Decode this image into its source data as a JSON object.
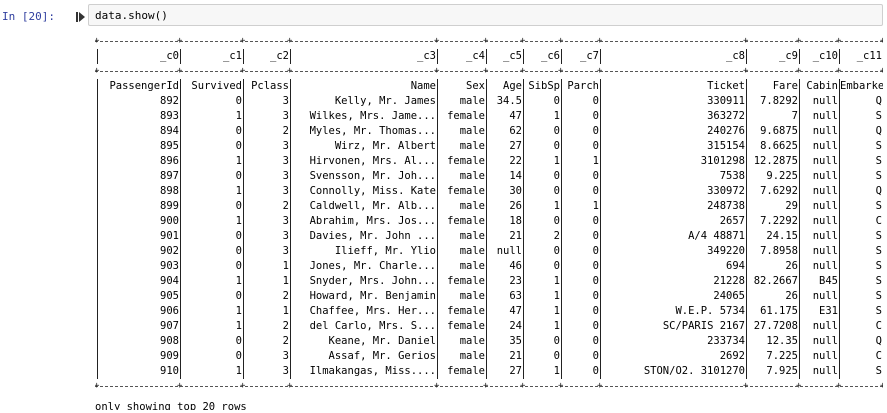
{
  "prompt_label": "In [20]:",
  "code": "data.show()",
  "columns_header": [
    "_c0",
    "_c1",
    "_c2",
    "_c3",
    "_c4",
    "_c5",
    "_c6",
    "_c7",
    "_c8",
    "_c9",
    "_c10",
    "_c11"
  ],
  "rows": [
    [
      "PassengerId",
      "Survived",
      "Pclass",
      "Name",
      "Sex",
      "Age",
      "SibSp",
      "Parch",
      "Ticket",
      "Fare",
      "Cabin",
      "Embarked"
    ],
    [
      "892",
      "0",
      "3",
      "Kelly, Mr. James",
      "male",
      "34.5",
      "0",
      "0",
      "330911",
      "7.8292",
      "null",
      "Q"
    ],
    [
      "893",
      "1",
      "3",
      "Wilkes, Mrs. Jame...",
      "female",
      "47",
      "1",
      "0",
      "363272",
      "7",
      "null",
      "S"
    ],
    [
      "894",
      "0",
      "2",
      "Myles, Mr. Thomas...",
      "male",
      "62",
      "0",
      "0",
      "240276",
      "9.6875",
      "null",
      "Q"
    ],
    [
      "895",
      "0",
      "3",
      "Wirz, Mr. Albert",
      "male",
      "27",
      "0",
      "0",
      "315154",
      "8.6625",
      "null",
      "S"
    ],
    [
      "896",
      "1",
      "3",
      "Hirvonen, Mrs. Al...",
      "female",
      "22",
      "1",
      "1",
      "3101298",
      "12.2875",
      "null",
      "S"
    ],
    [
      "897",
      "0",
      "3",
      "Svensson, Mr. Joh...",
      "male",
      "14",
      "0",
      "0",
      "7538",
      "9.225",
      "null",
      "S"
    ],
    [
      "898",
      "1",
      "3",
      "Connolly, Miss. Kate",
      "female",
      "30",
      "0",
      "0",
      "330972",
      "7.6292",
      "null",
      "Q"
    ],
    [
      "899",
      "0",
      "2",
      "Caldwell, Mr. Alb...",
      "male",
      "26",
      "1",
      "1",
      "248738",
      "29",
      "null",
      "S"
    ],
    [
      "900",
      "1",
      "3",
      "Abrahim, Mrs. Jos...",
      "female",
      "18",
      "0",
      "0",
      "2657",
      "7.2292",
      "null",
      "C"
    ],
    [
      "901",
      "0",
      "3",
      "Davies, Mr. John ...",
      "male",
      "21",
      "2",
      "0",
      "A/4 48871",
      "24.15",
      "null",
      "S"
    ],
    [
      "902",
      "0",
      "3",
      "Ilieff, Mr. Ylio",
      "male",
      "null",
      "0",
      "0",
      "349220",
      "7.8958",
      "null",
      "S"
    ],
    [
      "903",
      "0",
      "1",
      "Jones, Mr. Charle...",
      "male",
      "46",
      "0",
      "0",
      "694",
      "26",
      "null",
      "S"
    ],
    [
      "904",
      "1",
      "1",
      "Snyder, Mrs. John...",
      "female",
      "23",
      "1",
      "0",
      "21228",
      "82.2667",
      "B45",
      "S"
    ],
    [
      "905",
      "0",
      "2",
      "Howard, Mr. Benjamin",
      "male",
      "63",
      "1",
      "0",
      "24065",
      "26",
      "null",
      "S"
    ],
    [
      "906",
      "1",
      "1",
      "Chaffee, Mrs. Her...",
      "female",
      "47",
      "1",
      "0",
      "W.E.P. 5734",
      "61.175",
      "E31",
      "S"
    ],
    [
      "907",
      "1",
      "2",
      "del Carlo, Mrs. S...",
      "female",
      "24",
      "1",
      "0",
      "SC/PARIS 2167",
      "27.7208",
      "null",
      "C"
    ],
    [
      "908",
      "0",
      "2",
      "Keane, Mr. Daniel",
      "male",
      "35",
      "0",
      "0",
      "233734",
      "12.35",
      "null",
      "Q"
    ],
    [
      "909",
      "0",
      "3",
      "Assaf, Mr. Gerios",
      "male",
      "21",
      "0",
      "0",
      "2692",
      "7.225",
      "null",
      "C"
    ],
    [
      "910",
      "1",
      "3",
      "Ilmakangas, Miss....",
      "female",
      "27",
      "1",
      "0",
      "STON/O2. 3101270",
      "7.925",
      "null",
      "S"
    ]
  ],
  "footer": "only showing top 20 rows"
}
